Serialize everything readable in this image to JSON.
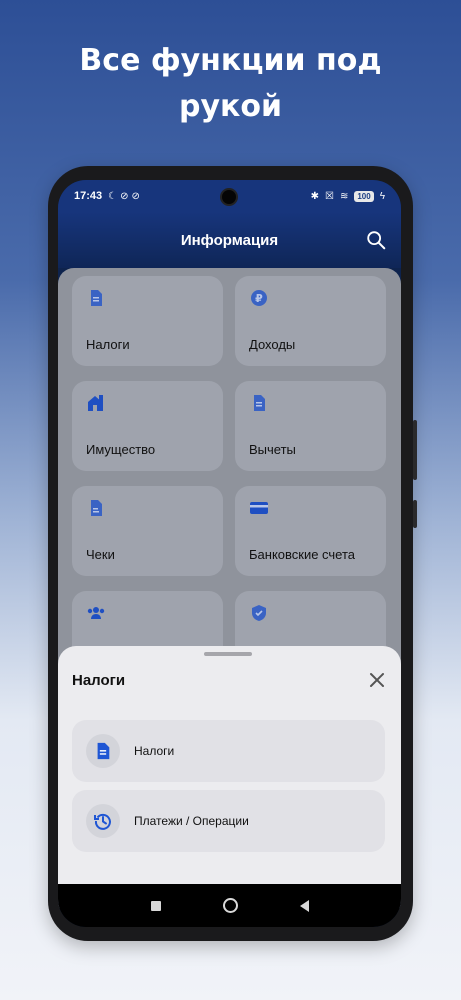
{
  "headline": "Все функции под рукой",
  "status": {
    "time": "17:43",
    "left_icons": [
      "moon-icon",
      "sync-icon",
      "sync-icon"
    ],
    "right_icons": [
      "bluetooth-icon",
      "sim-icon",
      "wifi-icon"
    ],
    "battery": "100"
  },
  "appbar": {
    "title": "Информация",
    "search_icon": "search-icon"
  },
  "tiles": [
    {
      "label": "Налоги",
      "icon": "document-icon"
    },
    {
      "label": "Доходы",
      "icon": "ruble-icon"
    },
    {
      "label": "Имущество",
      "icon": "house-icon"
    },
    {
      "label": "Вычеты",
      "icon": "document-icon"
    },
    {
      "label": "Чеки",
      "icon": "receipt-icon"
    },
    {
      "label": "Банковские счета",
      "icon": "card-icon"
    },
    {
      "label": "",
      "icon": "people-icon"
    },
    {
      "label": "",
      "icon": "shield-icon"
    }
  ],
  "sheet": {
    "title": "Налоги",
    "items": [
      {
        "label": "Налоги",
        "icon": "document-icon"
      },
      {
        "label": "Платежи / Операции",
        "icon": "history-icon"
      }
    ]
  },
  "colors": {
    "accent": "#1f56d4",
    "appbar": "#17357c"
  }
}
